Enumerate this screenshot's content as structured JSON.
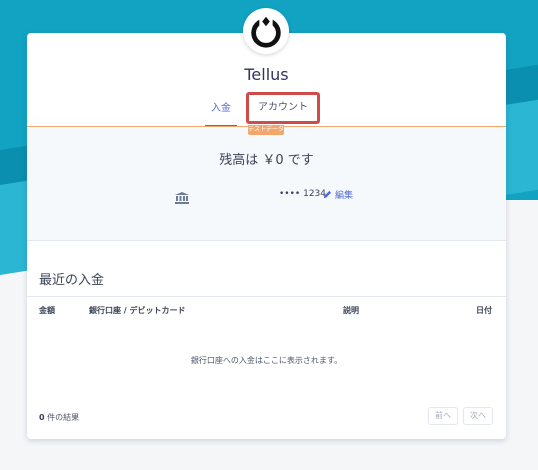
{
  "app": {
    "title": "Tellus",
    "logo_icon": "ring-logo-icon"
  },
  "tabs": [
    {
      "label": "入金",
      "active": true
    },
    {
      "label": "アカウント",
      "active": false
    }
  ],
  "test_badge": "テストデータ",
  "balance": {
    "text": "残高は ￥0 です",
    "account_icon": "bank-icon",
    "masked_number": "•••• 1234",
    "edit_label": "編集",
    "edit_icon": "pencil-icon"
  },
  "deposits": {
    "title": "最近の入金",
    "columns": [
      "金額",
      "銀行口座 / デビットカード",
      "説明",
      "日付"
    ],
    "empty_message": "銀行口座への入金はここに表示されます。",
    "result_count": "0",
    "result_suffix": " 件の結果",
    "prev_label": "前へ",
    "next_label": "次へ"
  },
  "colors": {
    "accent": "#5469d4",
    "highlight_border": "#d14b4b",
    "test_badge": "#f5a66b",
    "background_top": "#12a3c3"
  }
}
